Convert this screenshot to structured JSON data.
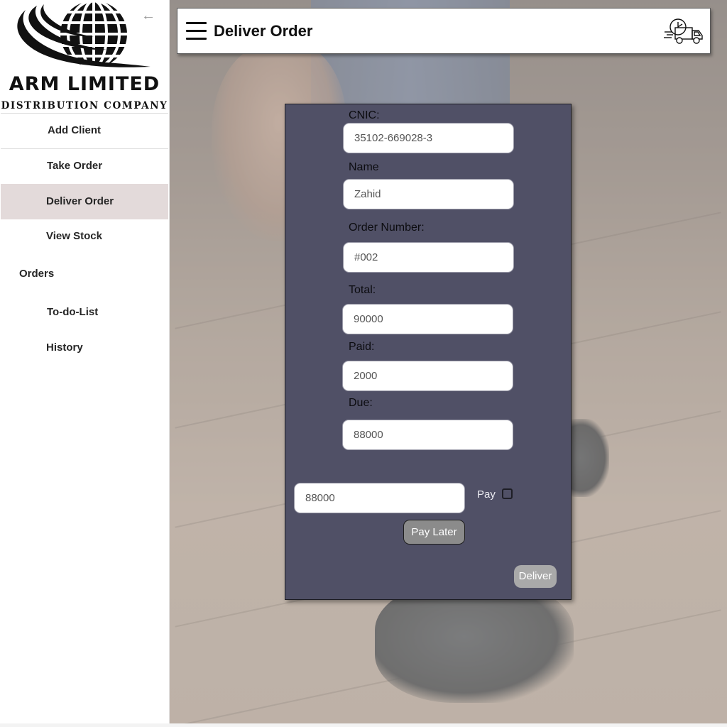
{
  "sidebar": {
    "logo": {
      "title": "ARM LIMITED",
      "subtitle": "DISTRIBUTION COMPANY"
    },
    "items": [
      {
        "label": "Add Client"
      },
      {
        "label": "Take Order"
      },
      {
        "label": "Deliver Order",
        "active": true
      },
      {
        "label": "View Stock"
      }
    ],
    "orders_heading": "Orders",
    "order_items": [
      {
        "label": "To-do-List"
      },
      {
        "label": "History"
      }
    ]
  },
  "header": {
    "title": "Deliver Order",
    "menu_icon": "hamburger-menu-icon",
    "truck_icon": "fast-delivery-truck-icon"
  },
  "form": {
    "cnic_label": "CNIC:",
    "cnic_value": "35102-669028-3",
    "name_label": "Name",
    "name_value": "Zahid",
    "order_number_label": "Order Number:",
    "order_number_value": "#002",
    "total_label": "Total:",
    "total_value": "90000",
    "paid_label": "Paid:",
    "paid_value": "2000",
    "due_label": "Due:",
    "due_value": "88000",
    "payment_value": "88000",
    "pay_label": "Pay",
    "pay_checked": false,
    "pay_later_label": "Pay Later",
    "deliver_label": "Deliver"
  },
  "colors": {
    "panel": "#505066",
    "active_nav": "#e3dada",
    "button_gray": "#8b8b8b"
  }
}
